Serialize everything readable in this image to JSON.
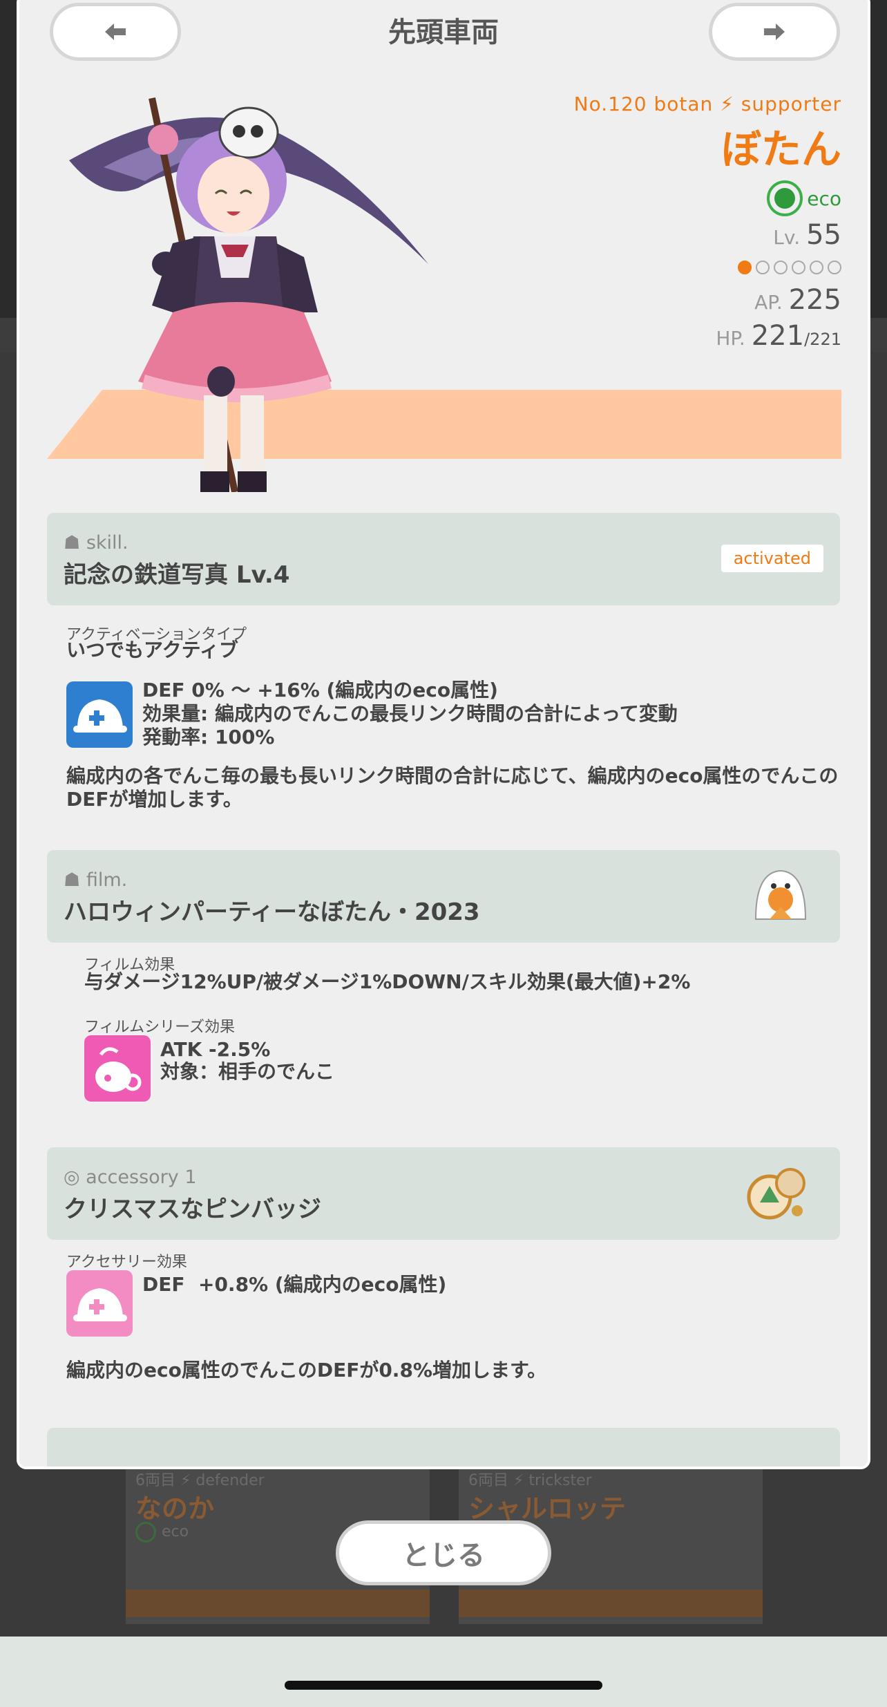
{
  "header": {
    "title": "先頭車両"
  },
  "character": {
    "number_line": "No.120 botan",
    "role": "supporter",
    "name": "ぼたん",
    "attribute": "eco",
    "lv_label": "Lv.",
    "lv_value": "55",
    "rank_filled": 1,
    "rank_total": 6,
    "ap_label": "AP.",
    "ap_value": "225",
    "hp_label": "HP.",
    "hp_value": "221",
    "hp_max": "/221"
  },
  "skill": {
    "kind": "skill.",
    "title": "記念の鉄道写真 Lv.4",
    "badge": "activated",
    "activation_label": "アクティベーションタイプ",
    "activation_value": "いつでもアクティブ",
    "effect_line1": "DEF 0% ～ +16% (編成内のeco属性)",
    "effect_line2": "効果量: 編成内のでんこの最長リンク時間の合計によって変動",
    "effect_line3": "発動率: 100%",
    "description": "編成内の各でんこ毎の最も長いリンク時間の合計に応じて、編成内のeco属性のでんこのDEFが増加します。"
  },
  "film": {
    "kind": "film.",
    "title": "ハロウィンパーティーなぼたん・2023",
    "effect_label": "フィルム効果",
    "effect_value": "与ダメージ12%UP/被ダメージ1%DOWN/スキル効果(最大値)+2%",
    "series_label": "フィルムシリーズ効果",
    "series_line1": "ATK -2.5%",
    "series_line2": "対象：相手のでんこ"
  },
  "accessory": {
    "kind": "accessory 1",
    "title": "クリスマスなピンバッジ",
    "effect_label": "アクセサリー効果",
    "effect_value": "DEF  +0.8% (編成内のeco属性)",
    "description": "編成内のeco属性のでんこのDEFが0.8%増加します。"
  },
  "background_cards": [
    {
      "sub": "6両目 ⚡ defender",
      "name": "なのか",
      "attr": "eco"
    },
    {
      "sub": "6両目 ⚡ trickster",
      "name": "シャルロッテ"
    }
  ],
  "close_button": "とじる",
  "colors": {
    "accent": "#f07a14",
    "eco": "#2e9a3c",
    "section_bg": "#d9e1dc",
    "band": "#ffc8a0"
  }
}
